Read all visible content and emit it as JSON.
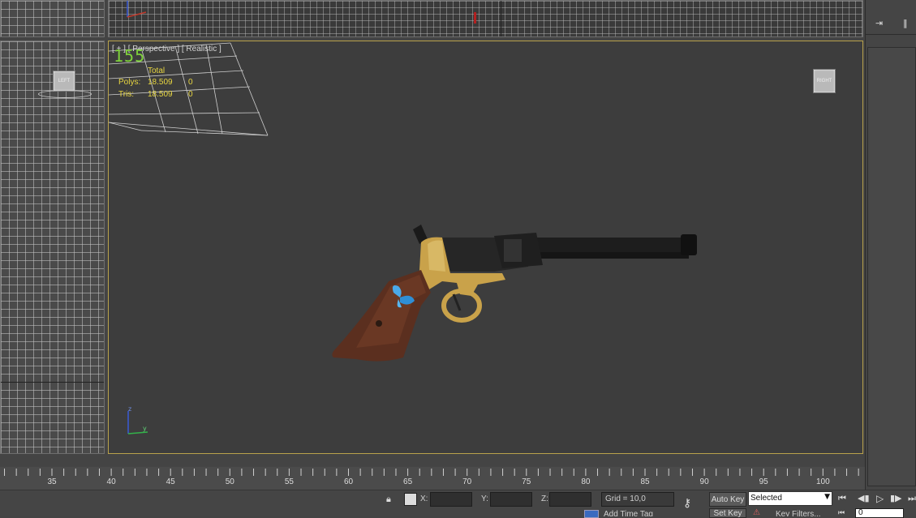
{
  "viewport": {
    "label_prefix": "[ + ]",
    "label_view": "[ Perspective ]",
    "label_shading": "[ Realistic ]",
    "fps": "155",
    "stats": {
      "total_header": "Total",
      "polys_label": "Polys:",
      "polys_total": "18.509",
      "polys_sel": "0",
      "tris_label": "Tris:",
      "tris_total": "18.509",
      "tris_sel": "0"
    },
    "viewcube_label": "RIGHT",
    "axis": {
      "z": "z",
      "y": "y"
    }
  },
  "left_viewport": {
    "viewcube_label": "LEFT"
  },
  "timeline": {
    "ticks": [
      "35",
      "40",
      "45",
      "50",
      "55",
      "60",
      "65",
      "70",
      "75",
      "80",
      "85",
      "90",
      "95",
      "100"
    ]
  },
  "statusbar": {
    "x_label": "X:",
    "y_label": "Y:",
    "z_label": "Z:",
    "grid": "Grid = 10,0",
    "auto_key": "Auto Key",
    "set_key": "Set Key",
    "selected_option": "Selected",
    "key_filters": "Key Filters...",
    "add_time_tag": "Add Time Tag",
    "frame_value": "0"
  },
  "colors": {
    "viewport_border": "#b9a24b",
    "fps": "#7fd23b",
    "stats": "#e8d640",
    "gizmo_blue": "#3a5bd6",
    "gizmo_green": "#33b24a"
  }
}
